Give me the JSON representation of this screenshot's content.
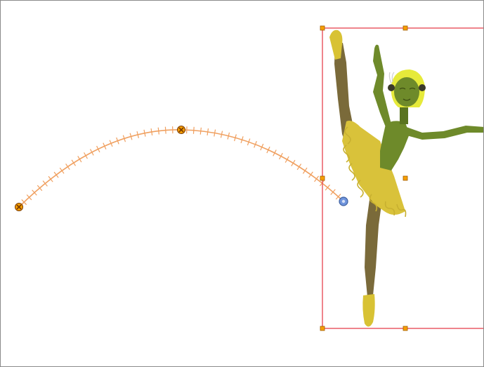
{
  "canvas": {
    "background": "#ffffff",
    "frame_color": "#8a8a8a"
  },
  "motion_path": {
    "color": "#f0a060",
    "keyframe_color": "#f6a000",
    "keyframe_outline": "#7a3a00",
    "current_frame_color": "#6f94dc",
    "keyframe_icon": "keyframe-marker-icon",
    "current_frame_icon": "current-frame-marker-icon"
  },
  "selection": {
    "box_color": "#e8505b",
    "handle_color": "#f6a000",
    "handle_icon": "resize-handle-icon",
    "pivot_icon": "pivot-point-icon"
  },
  "character": {
    "icon": "ballerina-character-icon",
    "colors": {
      "skin": "#6e8a2a",
      "skin_dark": "#5a7420",
      "leg": "#7a6a3a",
      "tutu": "#d9c23a",
      "shoe": "#d8c234",
      "hair": "#e6ea3a",
      "outline": "#c8b030"
    }
  }
}
